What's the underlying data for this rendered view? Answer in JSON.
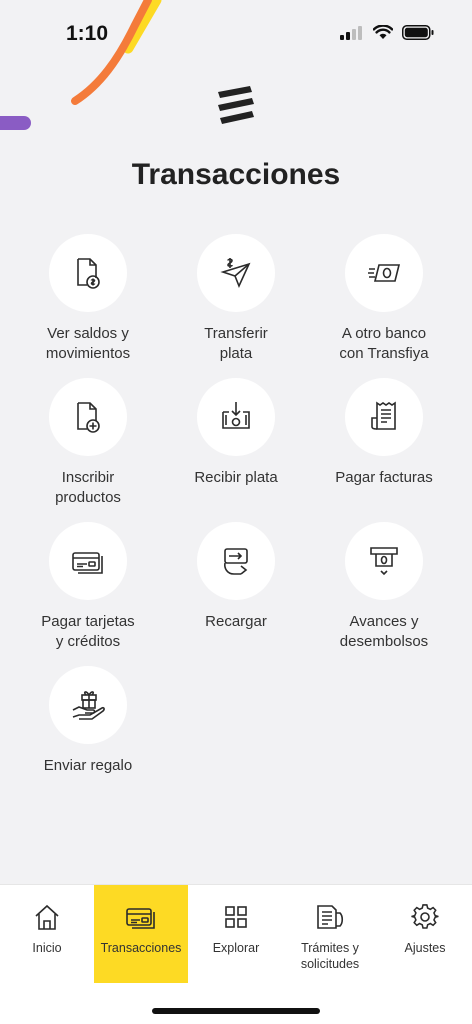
{
  "status": {
    "time": "1:10"
  },
  "page": {
    "title": "Transacciones"
  },
  "tiles": [
    {
      "label": "Ver saldos y\nmovimientos",
      "icon": "document-dollar-icon"
    },
    {
      "label": "Transferir\nplata",
      "icon": "paper-plane-dollar-icon"
    },
    {
      "label": "A otro banco\ncon Transfiya",
      "icon": "fast-money-icon"
    },
    {
      "label": "Inscribir\nproductos",
      "icon": "document-add-icon"
    },
    {
      "label": "Recibir plata",
      "icon": "receive-money-icon"
    },
    {
      "label": "Pagar facturas",
      "icon": "receipt-icon"
    },
    {
      "label": "Pagar tarjetas\ny créditos",
      "icon": "credit-cards-icon"
    },
    {
      "label": "Recargar",
      "icon": "phone-recharge-icon"
    },
    {
      "label": "Avances y\ndesembolsos",
      "icon": "atm-withdraw-icon"
    },
    {
      "label": "Enviar regalo",
      "icon": "gift-hand-icon"
    }
  ],
  "nav": {
    "items": [
      {
        "label": "Inicio",
        "icon": "home-icon"
      },
      {
        "label": "Transacciones",
        "icon": "cards-icon"
      },
      {
        "label": "Explorar",
        "icon": "grid-icon"
      },
      {
        "label": "Trámites y\nsolicitudes",
        "icon": "documents-icon"
      },
      {
        "label": "Ajustes",
        "icon": "gear-icon"
      }
    ],
    "active_index": 1
  },
  "colors": {
    "accent": "#fdda24",
    "background": "#f2f2f4",
    "deco_orange": "#f47b3a",
    "deco_yellow": "#fdda24",
    "deco_purple": "#8a5cc4"
  }
}
